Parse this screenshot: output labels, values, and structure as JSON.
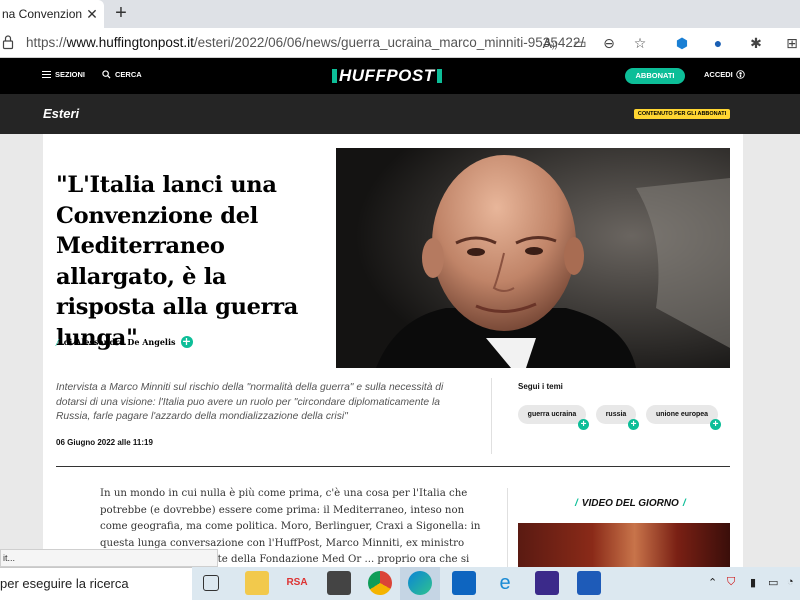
{
  "browser": {
    "tab_title": "na Convenzione d",
    "tab_close": "✕",
    "new_tab": "+",
    "url_prefix": "https://",
    "url_host": "www.huffingtonpost.it",
    "url_path": "/esteri/2022/06/06/news/guerra_ucraina_marco_minniti-9535422/"
  },
  "site": {
    "menu_label": "SEZIONI",
    "search_label": "CERCA",
    "logo": "HUFFPOST",
    "subscribe_label": "ABBONATI",
    "login_label": "ACCEDI",
    "accent_color": "#0dbe98"
  },
  "section": {
    "name": "Esteri",
    "badge": "CONTENUTO PER GLI ABBONATI"
  },
  "article": {
    "headline": "\"L'Italia lanci una Convenzione del Mediterraneo allargato, è la risposta alla guerra lunga\"",
    "byline_prefix": "/",
    "byline": "di Alessandro De Angelis",
    "standfirst": "Intervista a Marco Minniti sul rischio della \"normalità della guerra\" e sulla necessità di dotarsi di una visione: l'Italia puo avere un ruolo per \"circondare diplomaticamente la Russia, farle pagare l'azzardo della mondializzazione della crisi\"",
    "date": "06 Giugno 2022 alle 11:19",
    "body": "In un mondo in cui nulla è più come prima, c'è una cosa per l'Italia che potrebbe (e dovrebbe) essere come prima: il Mediterraneo, inteso non come geografia, ma come politica. Moro, Berlinguer, Craxi a Sigonella: in questa lunga conversazione con l'HuffPost, Marco Minniti, ex ministro dell'Interno e presidente della Fondazione Med Or ... proprio ora che si paventa una drammatica crisi del grano."
  },
  "topics": {
    "title": "Segui i temi",
    "tags": [
      "guerra ucraina",
      "russia",
      "unione europea"
    ]
  },
  "video": {
    "title": "VIDEO DEL GIORNO"
  },
  "status_popup": "it...",
  "taskbar": {
    "search_placeholder": "per eseguire la ricerca"
  }
}
